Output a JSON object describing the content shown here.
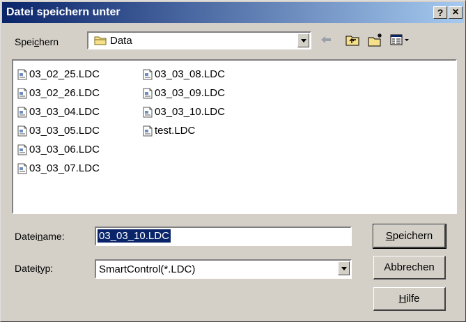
{
  "dialog": {
    "title": "Datei speichern unter",
    "help_btn": "?",
    "close_btn": "×"
  },
  "savein": {
    "label_pre": "Spei",
    "label_u": "c",
    "label_post": "hern",
    "value": "Data"
  },
  "files": {
    "col1": [
      "03_02_25.LDC",
      "03_02_26.LDC",
      "03_03_04.LDC",
      "03_03_05.LDC",
      "03_03_06.LDC",
      "03_03_07.LDC"
    ],
    "col2": [
      "03_03_08.LDC",
      "03_03_09.LDC",
      "03_03_10.LDC",
      "test.LDC"
    ]
  },
  "filename": {
    "label_pre": "Datei",
    "label_u": "n",
    "label_post": "ame:",
    "value": "03_03_10.LDC"
  },
  "filetype": {
    "label_pre": "Datei",
    "label_u": "t",
    "label_post": "yp:",
    "value": "SmartControl(*.LDC)"
  },
  "buttons": {
    "save_u": "S",
    "save_rest": "peichern",
    "cancel": "Abbrechen",
    "help_u": "H",
    "help_rest": "ilfe"
  }
}
